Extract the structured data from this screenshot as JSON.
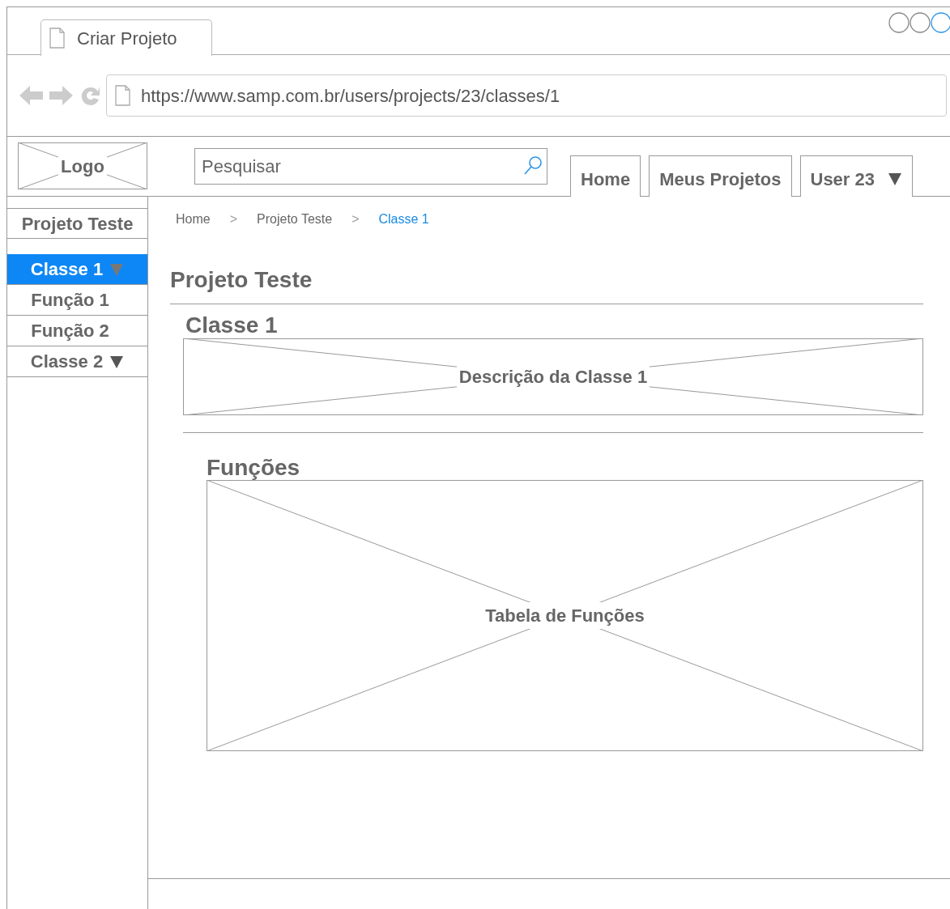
{
  "tab": {
    "title": "Criar Projeto"
  },
  "address_bar": {
    "url": "https://www.samp.com.br/users/projects/23/classes/1"
  },
  "header": {
    "logo": "Logo",
    "search": {
      "placeholder": "Pesquisar"
    },
    "nav": [
      {
        "label": "Home",
        "kind": "link"
      },
      {
        "label": "Meus Projetos",
        "kind": "link"
      },
      {
        "label": "User 23",
        "kind": "dropdown"
      }
    ]
  },
  "sidebar": {
    "project": "Projeto Teste",
    "items": [
      {
        "label": "Classe 1",
        "kind": "group",
        "selected": true,
        "children": [
          {
            "label": "Função 1",
            "kind": "leaf",
            "selected": false
          },
          {
            "label": "Função 2",
            "kind": "leaf",
            "selected": false
          }
        ]
      },
      {
        "label": "Classe 2",
        "kind": "group",
        "selected": false
      }
    ]
  },
  "breadcrumb": {
    "separator": ">",
    "items": [
      {
        "label": "Home",
        "current": false
      },
      {
        "label": "Projeto Teste",
        "current": false
      },
      {
        "label": "Classe 1",
        "current": true
      }
    ]
  },
  "content": {
    "title": "Projeto Teste",
    "class_title": "Classe 1",
    "description": "Descrição da Classe 1",
    "functions_title": "Funções",
    "functions_table": "Tabela de Funções"
  }
}
